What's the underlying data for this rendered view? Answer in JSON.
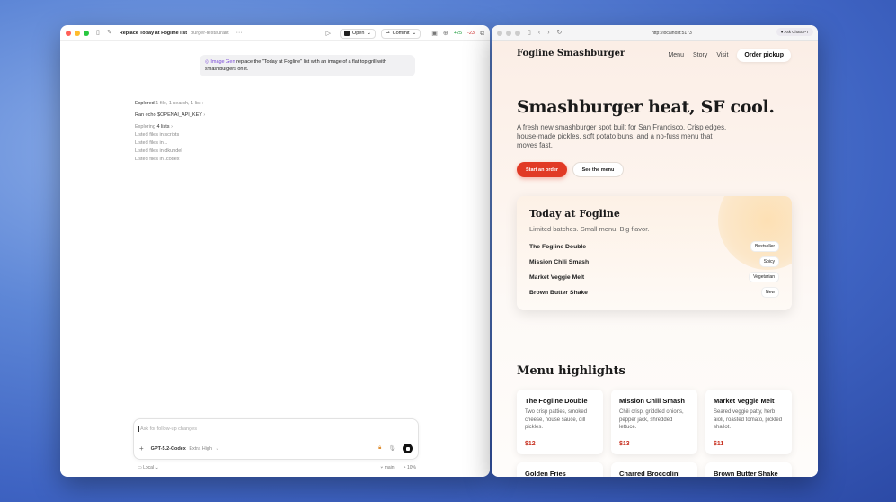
{
  "left_window": {
    "title": "Replace Today at Fogline list",
    "project": "burger-restaurant",
    "more": "···",
    "open_label": "Open",
    "commit_label": "Commit",
    "diff_add": "+25",
    "diff_del": "-23",
    "user_message": {
      "tag": "Image Gen",
      "text": "replace the \"Today at Fogline\" list with an image of a flat top grill with smashburgers on it."
    },
    "activity": [
      {
        "main": "Explored",
        "detail": "1 file, 1 search, 1 list"
      },
      {
        "main": "Ran echo $OPENAI_API_KEY",
        "detail": ""
      },
      {
        "main": "Exploring",
        "detail": "4 lists"
      }
    ],
    "sub_activity": [
      "Listed files in scripts",
      "Listed files in ..",
      "Listed files in dkundel",
      "Listed files in .codex"
    ],
    "composer": {
      "placeholder": "Ask for follow-up changes",
      "model": "GPT-5.2-Codex",
      "model_effort": "Extra High"
    },
    "footer": {
      "env": "Local",
      "branch": "main",
      "context": "10%"
    }
  },
  "right_window": {
    "url": "http://localhost:5173",
    "ask_label": "Ask ChatGPT",
    "site": {
      "brand": "Fogline Smashburger",
      "nav": [
        "Menu",
        "Story",
        "Visit"
      ],
      "cta": "Order pickup",
      "hero_title": "Smashburger heat, SF cool.",
      "hero_sub": "A fresh new smashburger spot built for San Francisco. Crisp edges, house-made pickles, soft potato buns, and a no-fuss menu that moves fast.",
      "primary_btn": "Start an order",
      "secondary_btn": "See the menu",
      "today": {
        "title": "Today at Fogline",
        "subtitle": "Limited batches. Small menu. Big flavor.",
        "items": [
          {
            "name": "The Fogline Double",
            "badge": "Bestseller"
          },
          {
            "name": "Mission Chili Smash",
            "badge": "Spicy"
          },
          {
            "name": "Market Veggie Melt",
            "badge": "Vegetarian"
          },
          {
            "name": "Brown Butter Shake",
            "badge": "New"
          }
        ]
      },
      "menu_title": "Menu highlights",
      "menu": [
        {
          "name": "The Fogline Double",
          "desc": "Two crisp patties, smoked cheese, house sauce, dill pickles.",
          "price": "$12"
        },
        {
          "name": "Mission Chili Smash",
          "desc": "Chili crisp, griddled onions, pepper jack, shredded lettuce.",
          "price": "$13"
        },
        {
          "name": "Market Veggie Melt",
          "desc": "Seared veggie patty, herb aioli, roasted tomato, pickled shallot.",
          "price": "$11"
        }
      ],
      "menu_row2": [
        "Golden Fries",
        "Charred Broccolini",
        "Brown Butter Shake"
      ]
    }
  }
}
